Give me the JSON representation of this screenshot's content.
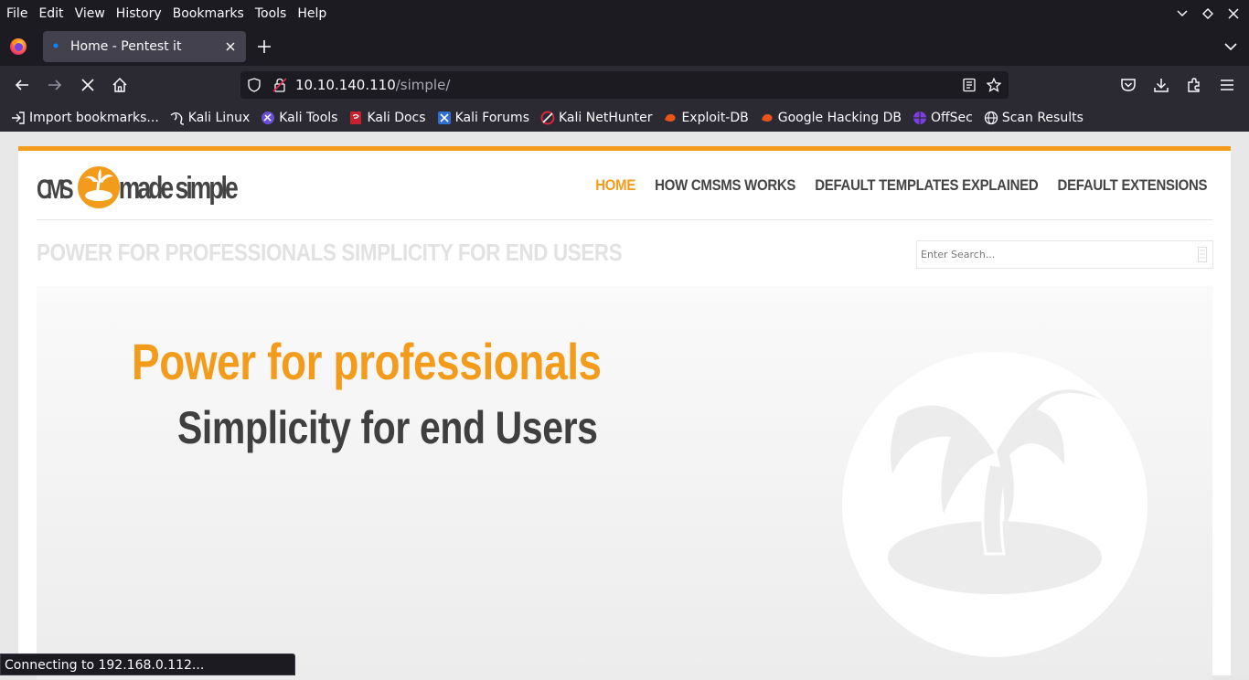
{
  "menubar": {
    "items": [
      "File",
      "Edit",
      "View",
      "History",
      "Bookmarks",
      "Tools",
      "Help"
    ]
  },
  "tab": {
    "title": "Home - Pentest it"
  },
  "urlbar": {
    "host": "10.10.140.110",
    "path": "/simple/"
  },
  "bookmarks": [
    {
      "label": "Import bookmarks...",
      "icon": "import-icon"
    },
    {
      "label": "Kali Linux",
      "icon": "kali-dragon-icon"
    },
    {
      "label": "Kali Tools",
      "icon": "kali-tools-icon"
    },
    {
      "label": "Kali Docs",
      "icon": "kali-docs-icon"
    },
    {
      "label": "Kali Forums",
      "icon": "kali-forums-icon"
    },
    {
      "label": "Kali NetHunter",
      "icon": "kali-nethunter-icon"
    },
    {
      "label": "Exploit-DB",
      "icon": "exploit-db-icon"
    },
    {
      "label": "Google Hacking DB",
      "icon": "ghdb-icon"
    },
    {
      "label": "OffSec",
      "icon": "offsec-icon"
    },
    {
      "label": "Scan Results",
      "icon": "globe-icon"
    }
  ],
  "site": {
    "nav": [
      "HOME",
      "HOW CMSMS WORKS",
      "DEFAULT TEMPLATES EXPLAINED",
      "DEFAULT EXTENSIONS"
    ],
    "tagline": "POWER FOR PROFESSIONALS SIMPLICITY FOR END USERS",
    "search_placeholder": "Enter Search...",
    "headline": "Power for professionals",
    "subline": "Simplicity for end Users",
    "accent_color": "#f39c1c"
  },
  "status": "Connecting to 192.168.0.112..."
}
